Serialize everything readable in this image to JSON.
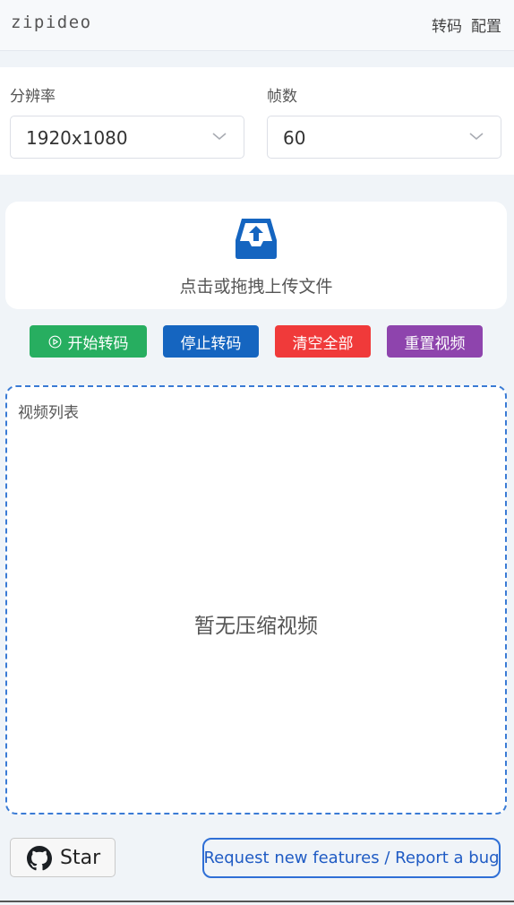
{
  "header": {
    "app_title": "zipideo",
    "nav": [
      "转码",
      "配置"
    ]
  },
  "settings": {
    "resolution": {
      "label": "分辨率",
      "value": "1920x1080"
    },
    "framerate": {
      "label": "帧数",
      "value": "60"
    }
  },
  "upload": {
    "text": "点击或拖拽上传文件",
    "icon": "inbox-upload-icon"
  },
  "actions": {
    "start": "开始转码",
    "stop": "停止转码",
    "clear": "清空全部",
    "reset": "重置视频"
  },
  "video_list": {
    "title": "视频列表",
    "empty_text": "暂无压缩视频"
  },
  "footer": {
    "star_label": "Star",
    "report_label": "Request new features / Report a bug"
  },
  "colors": {
    "accent_blue": "#1565c0",
    "start_green": "#27ae60",
    "clear_red": "#f03a3a",
    "reset_purple": "#8e44ad",
    "dashed_border": "#3a7bd5"
  }
}
